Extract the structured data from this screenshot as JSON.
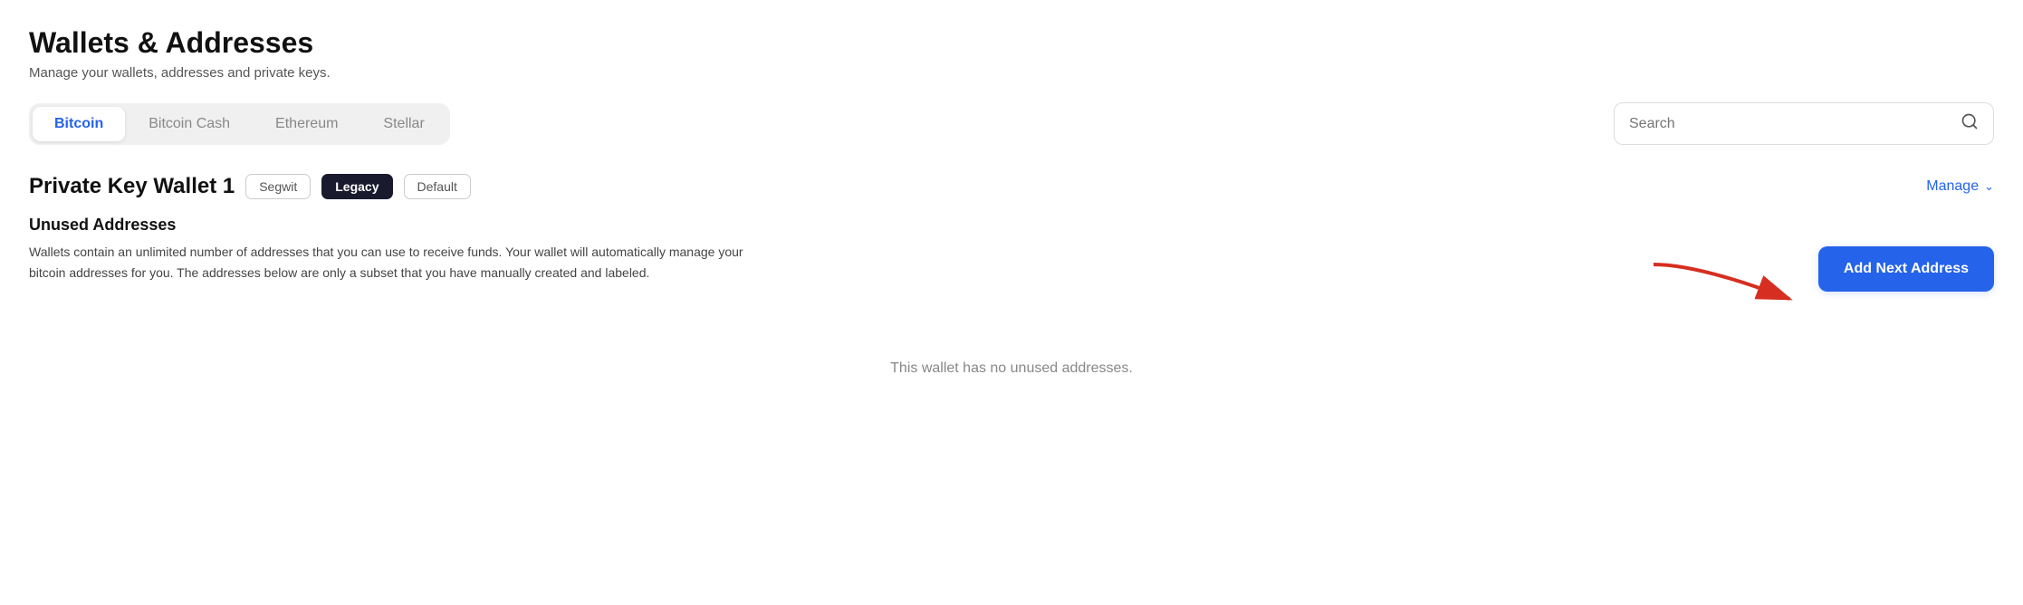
{
  "header": {
    "title": "Wallets & Addresses",
    "subtitle": "Manage your wallets, addresses and private keys."
  },
  "tabs": [
    {
      "id": "bitcoin",
      "label": "Bitcoin",
      "active": true
    },
    {
      "id": "bitcoin-cash",
      "label": "Bitcoin Cash",
      "active": false
    },
    {
      "id": "ethereum",
      "label": "Ethereum",
      "active": false
    },
    {
      "id": "stellar",
      "label": "Stellar",
      "active": false
    }
  ],
  "search": {
    "placeholder": "Search"
  },
  "wallet": {
    "name": "Private Key Wallet 1",
    "badges": [
      {
        "id": "segwit",
        "label": "Segwit",
        "active": false
      },
      {
        "id": "legacy",
        "label": "Legacy",
        "active": true
      },
      {
        "id": "default",
        "label": "Default",
        "active": false
      }
    ],
    "manage_label": "Manage"
  },
  "unused_addresses": {
    "title": "Unused Addresses",
    "description": "Wallets contain an unlimited number of addresses that you can use to receive funds. Your wallet will automatically manage your bitcoin addresses for you. The addresses below are only a subset that you have manually created and labeled.",
    "empty_message": "This wallet has no unused addresses.",
    "add_button_label": "Add Next Address"
  },
  "colors": {
    "accent_blue": "#2563eb",
    "active_badge_bg": "#1a1a2e",
    "arrow_red": "#d62e20"
  }
}
